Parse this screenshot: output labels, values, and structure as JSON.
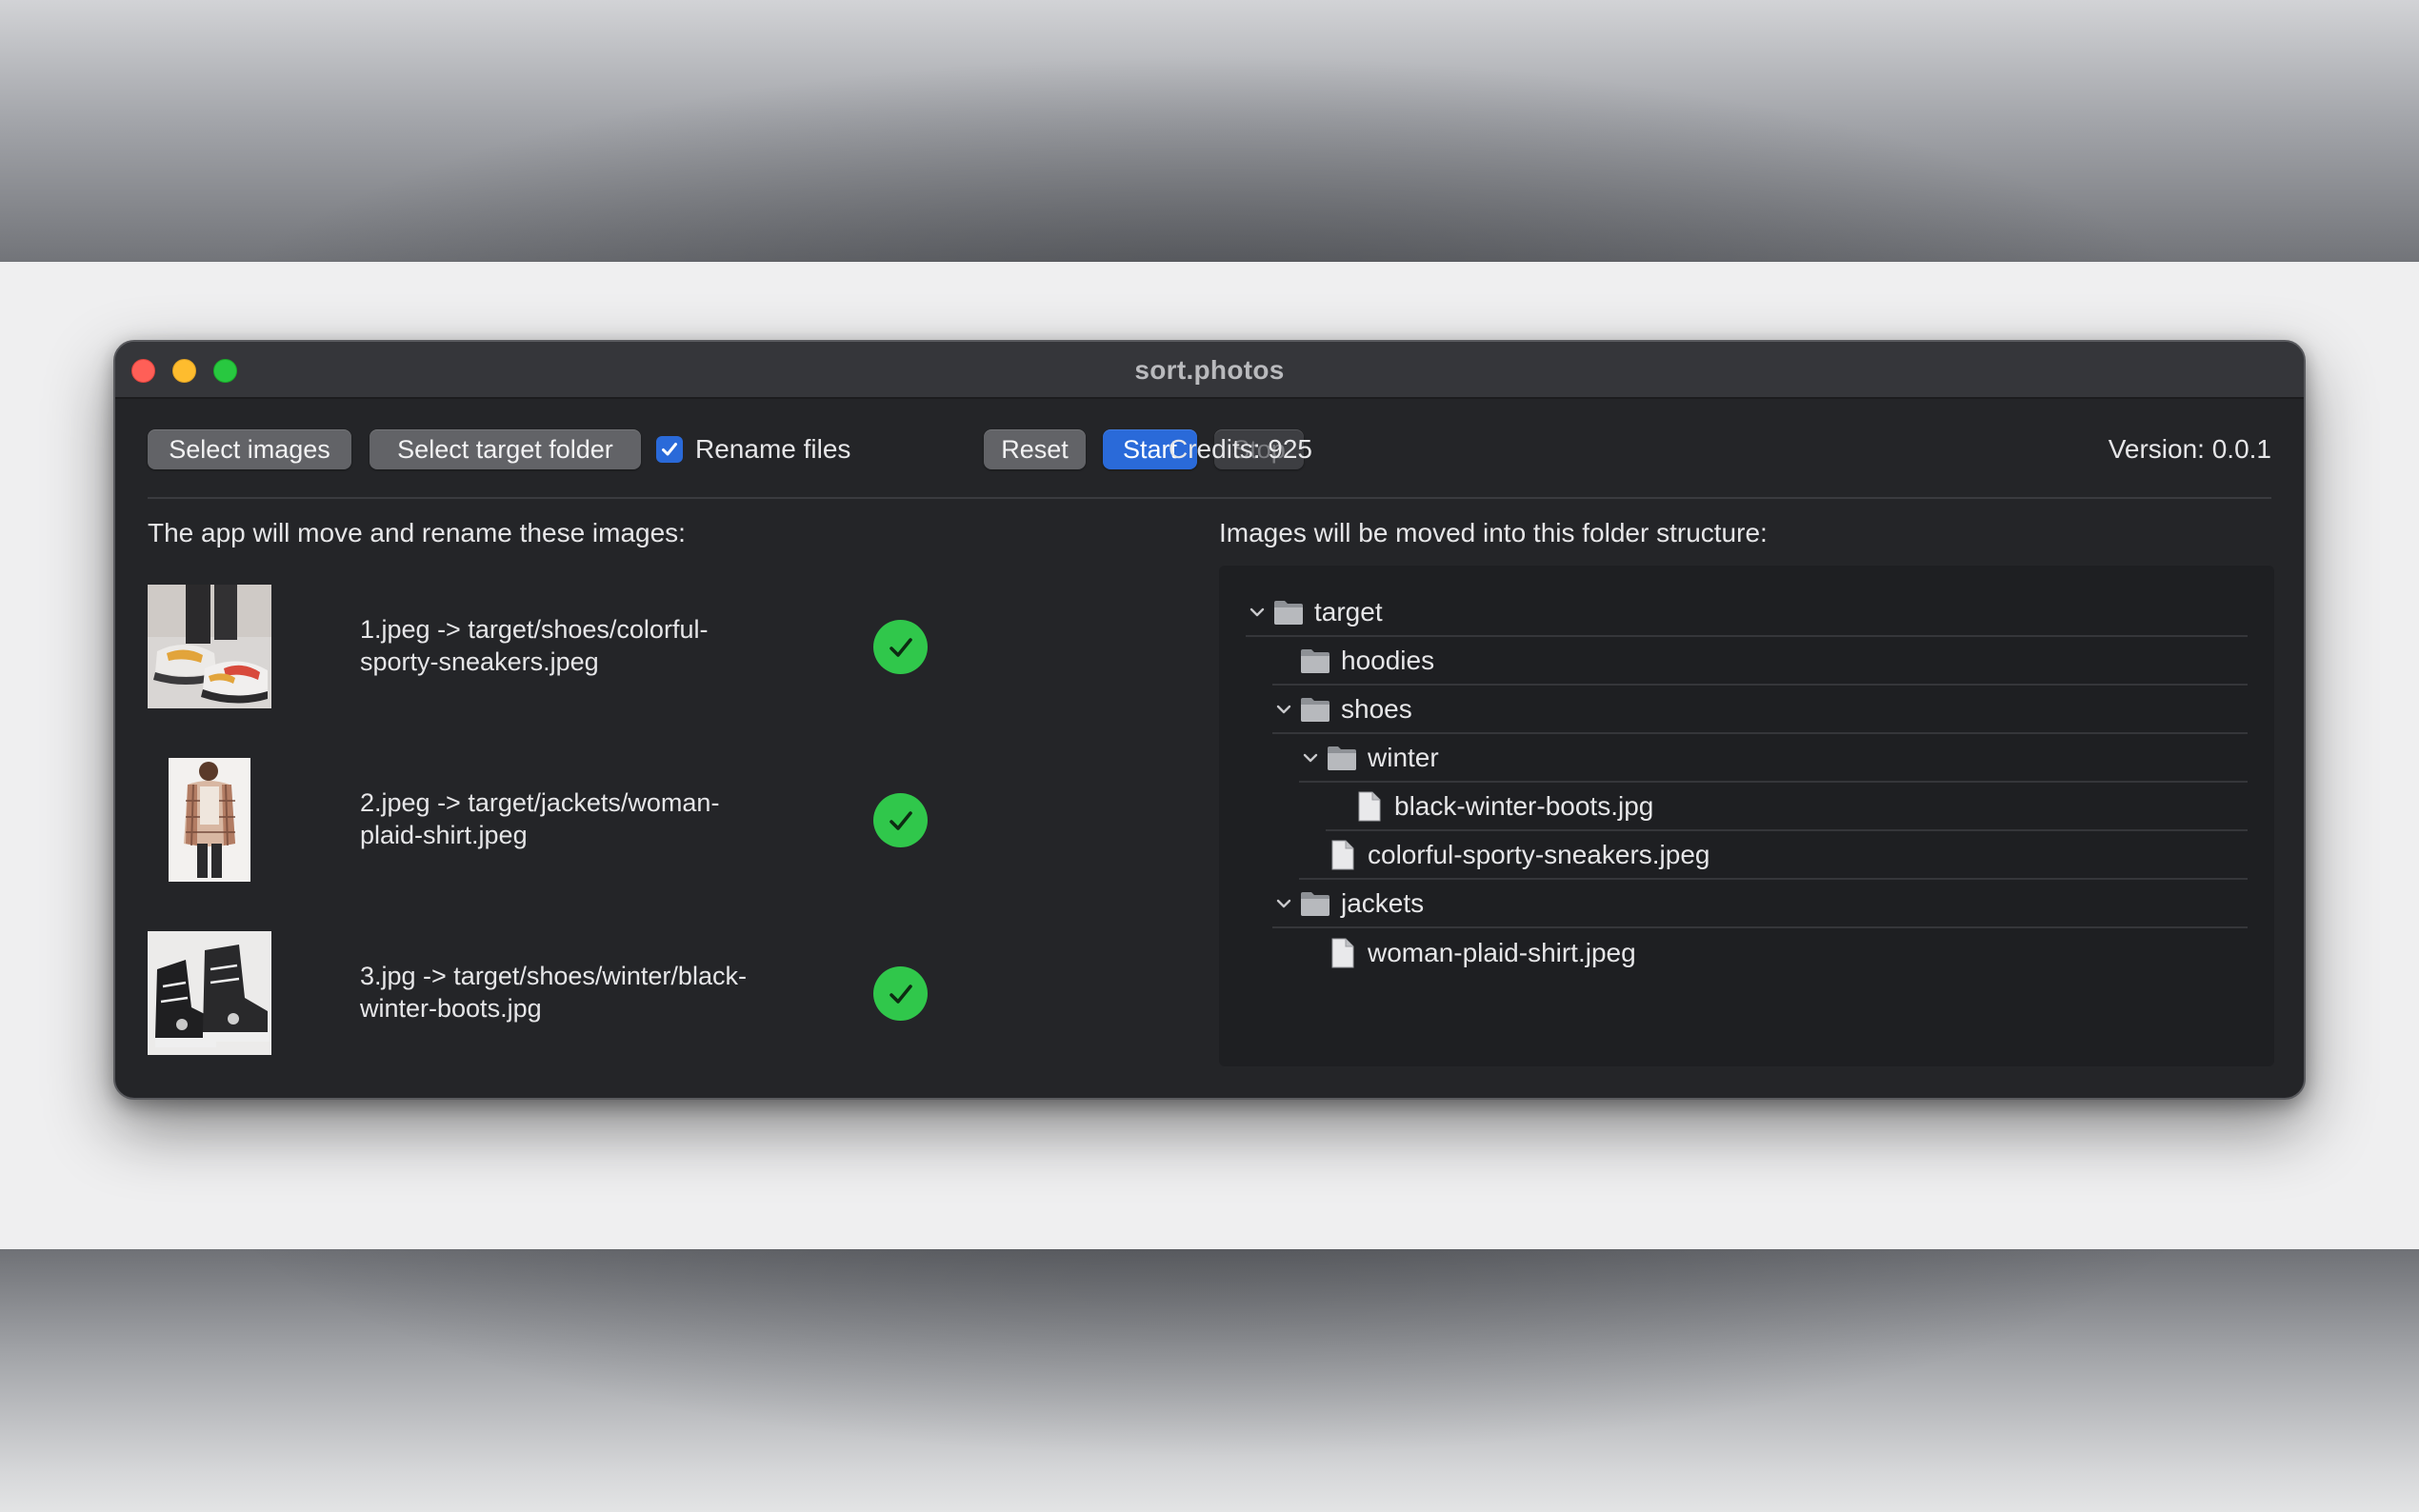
{
  "window": {
    "title": "sort.photos"
  },
  "toolbar": {
    "select_images": "Select images",
    "select_target_folder": "Select target folder",
    "rename_files_label": "Rename files",
    "rename_files_checked": true,
    "reset": "Reset",
    "start": "Start",
    "stop": "Stop",
    "credits": "Credits: 925",
    "version": "Version: 0.0.1"
  },
  "left": {
    "heading": "The app will move and rename these images:",
    "items": [
      {
        "line1": "1.jpeg -> target/shoes/colorful-",
        "line2": "sporty-sneakers.jpeg",
        "status": "done",
        "thumb": "sneakers-photo"
      },
      {
        "line1": "2.jpeg -> target/jackets/woman-",
        "line2": "plaid-shirt.jpeg",
        "status": "done",
        "thumb": "plaid-shirt-photo"
      },
      {
        "line1": "3.jpg -> target/shoes/winter/black-",
        "line2": "winter-boots.jpg",
        "status": "done",
        "thumb": "winter-boots-photo"
      }
    ]
  },
  "right": {
    "heading": "Images will be moved into this folder structure:",
    "tree": [
      {
        "label": "target",
        "type": "folder",
        "depth": 0,
        "expanded": true
      },
      {
        "label": "hoodies",
        "type": "folder",
        "depth": 1,
        "expanded": false
      },
      {
        "label": "shoes",
        "type": "folder",
        "depth": 1,
        "expanded": true
      },
      {
        "label": "winter",
        "type": "folder",
        "depth": 2,
        "expanded": true
      },
      {
        "label": "black-winter-boots.jpg",
        "type": "file",
        "depth": 3
      },
      {
        "label": "colorful-sporty-sneakers.jpeg",
        "type": "file",
        "depth": 2
      },
      {
        "label": "jackets",
        "type": "folder",
        "depth": 1,
        "expanded": true
      },
      {
        "label": "woman-plaid-shirt.jpeg",
        "type": "file",
        "depth": 2
      }
    ]
  },
  "colors": {
    "accent": "#2a6ad9",
    "success": "#30c74b",
    "window_bg": "#242528"
  }
}
